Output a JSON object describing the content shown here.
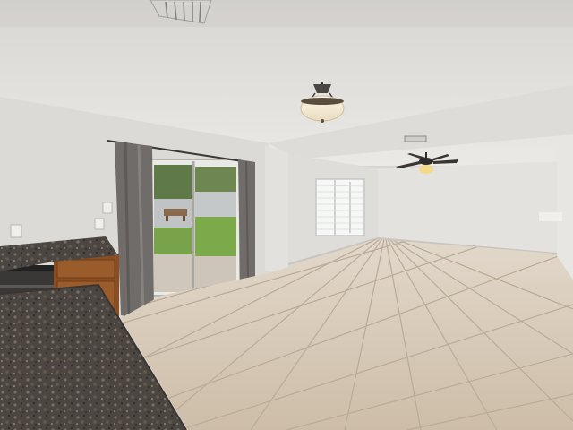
{
  "scene": {
    "subject": "empty-living-room-interior",
    "elements": [
      "textured-ceiling",
      "ceiling-light-fixture",
      "ceiling-fan",
      "hvac-vent",
      "sliding-glass-door",
      "curtains",
      "window-with-blinds",
      "granite-countertop",
      "wood-cabinet",
      "dishwasher",
      "tile-floor"
    ],
    "colors": {
      "ceiling": "#e4e2df",
      "wall_left": "#dcdad6",
      "wall_back": "#e0dedb",
      "floor": "#d6c8b5",
      "grout": "#b9ab98",
      "curtain": "#6f6c6a",
      "cabinet": "#8a4e22",
      "counter": "#4b4641",
      "grass": "#79a34a",
      "window_glass": "#eef1f2"
    }
  }
}
